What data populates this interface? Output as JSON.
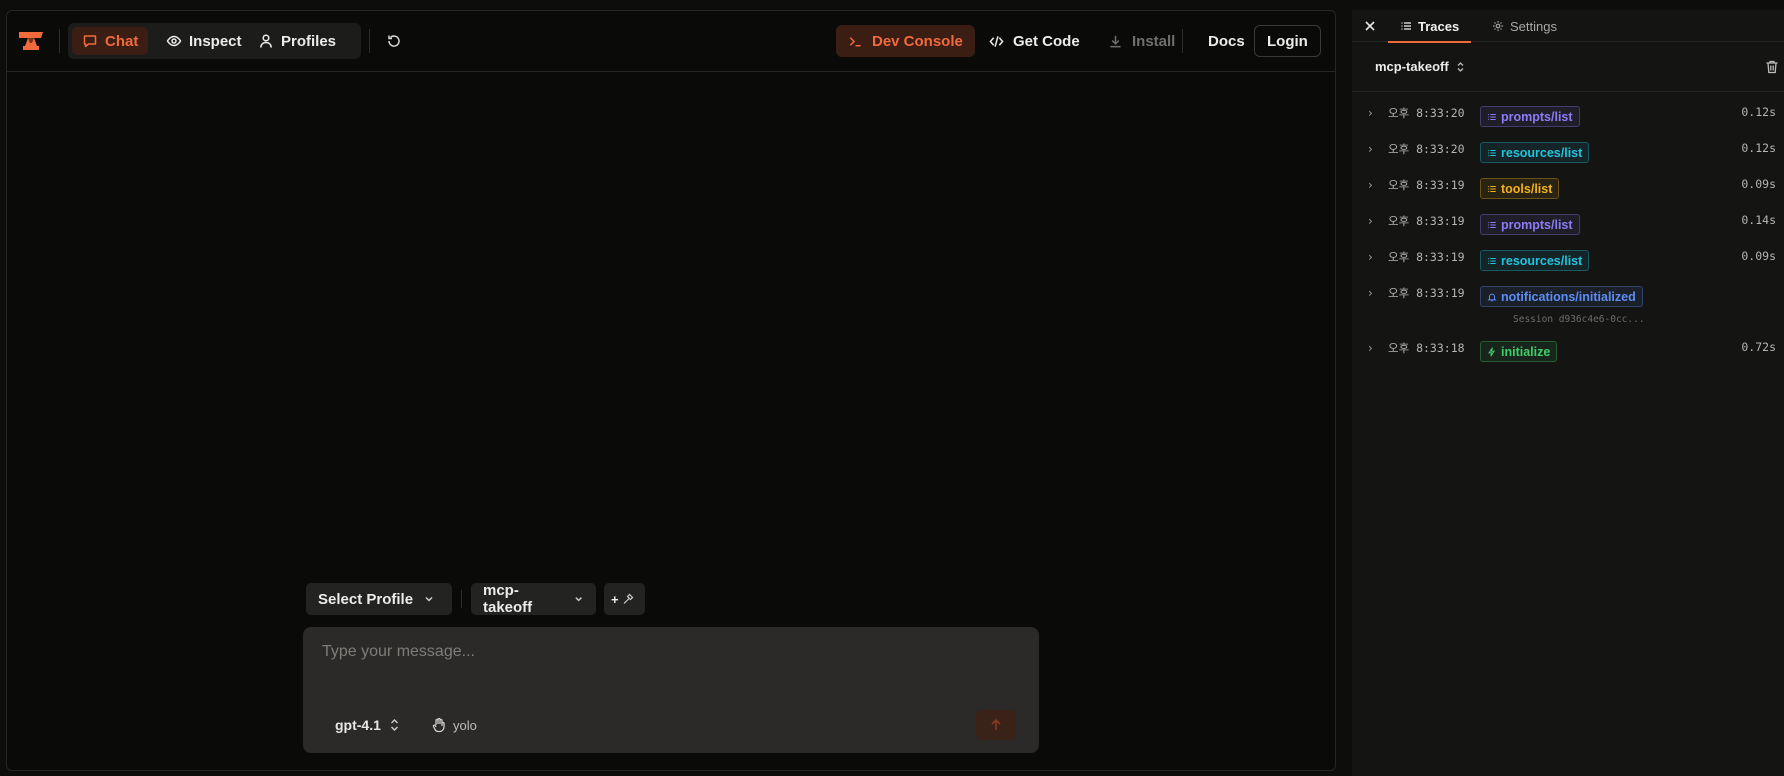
{
  "header": {
    "nav": [
      {
        "label": "Chat",
        "icon": "chat-bubble-icon",
        "active": true
      },
      {
        "label": "Inspect",
        "icon": "eye-icon",
        "active": false
      },
      {
        "label": "Profiles",
        "icon": "user-icon",
        "active": false
      }
    ],
    "dev_console_label": "Dev Console",
    "get_code_label": "Get Code",
    "install_label": "Install",
    "docs_label": "Docs",
    "login_label": "Login",
    "accent_color": "#f16a3c"
  },
  "composer": {
    "profile_select": "Select Profile",
    "server_select": "mcp-takeoff",
    "add_tool_label": "+",
    "placeholder": "Type your message...",
    "model": "gpt-4.1",
    "mode": "yolo"
  },
  "sidebar": {
    "tabs": [
      {
        "label": "Traces",
        "icon": "list-icon",
        "active": true
      },
      {
        "label": "Settings",
        "icon": "gear-icon",
        "active": false
      }
    ],
    "server": "mcp-takeoff",
    "traces": [
      {
        "time": "오후 8:33:20",
        "method": "prompts/list",
        "kind": "prompts",
        "duration": "0.12s"
      },
      {
        "time": "오후 8:33:20",
        "method": "resources/list",
        "kind": "resources",
        "duration": "0.12s"
      },
      {
        "time": "오후 8:33:19",
        "method": "tools/list",
        "kind": "tools",
        "duration": "0.09s"
      },
      {
        "time": "오후 8:33:19",
        "method": "prompts/list",
        "kind": "prompts",
        "duration": "0.14s"
      },
      {
        "time": "오후 8:33:19",
        "method": "resources/list",
        "kind": "resources",
        "duration": "0.09s"
      },
      {
        "time": "오후 8:33:19",
        "method": "notifications/initialized",
        "kind": "notification",
        "duration": "",
        "sub": "Session d936c4e6-0cc..."
      },
      {
        "time": "오후 8:33:18",
        "method": "initialize",
        "kind": "initialize",
        "duration": "0.72s"
      }
    ]
  },
  "method_colors": {
    "prompts": "#8b7cf6",
    "resources": "#22c3dd",
    "tools": "#f2b21d",
    "notification": "#5b8ef5",
    "initialize": "#3fcf6a"
  }
}
